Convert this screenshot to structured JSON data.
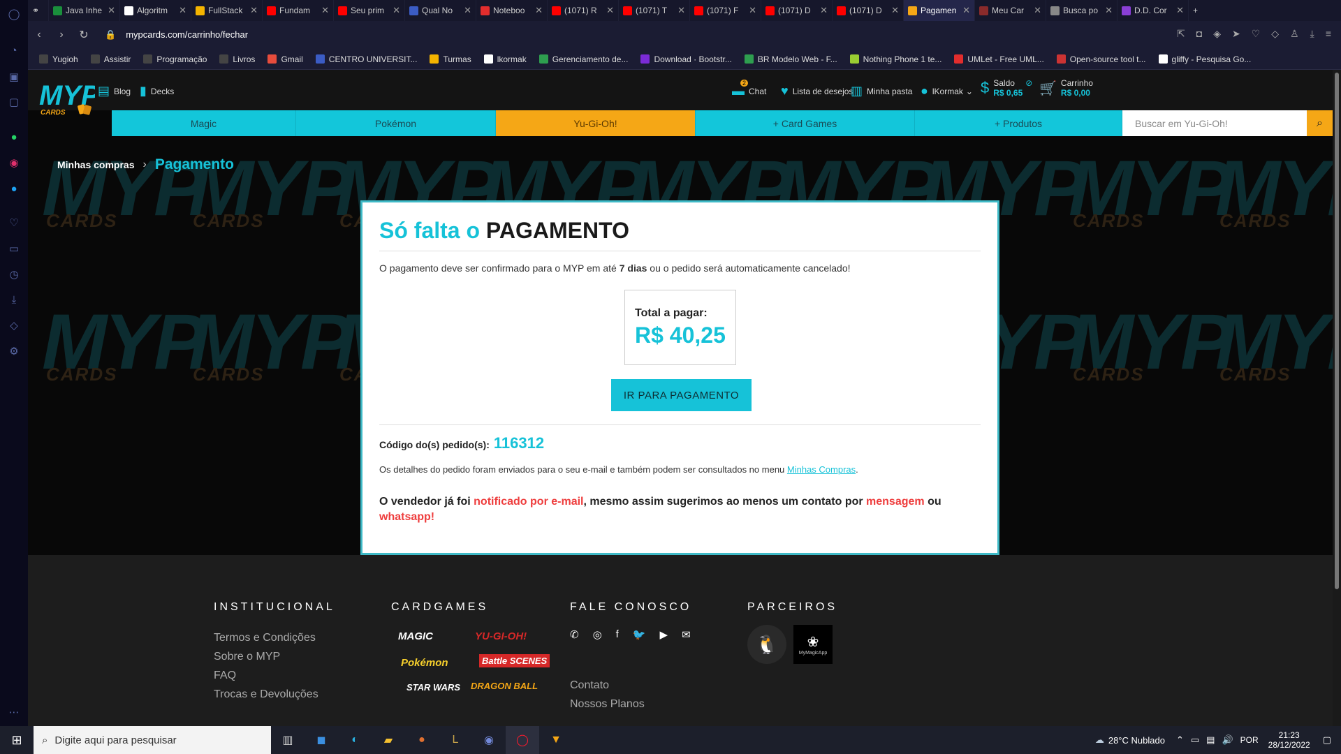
{
  "browser": {
    "tabs": [
      {
        "label": "Java Inhe",
        "color": "#1a8f3c"
      },
      {
        "label": "Algoritm",
        "color": "#ffffff"
      },
      {
        "label": "FullStack",
        "color": "#f4b400"
      },
      {
        "label": "Fundam",
        "color": "#ff0000"
      },
      {
        "label": "Seu prim",
        "color": "#ff0000"
      },
      {
        "label": "Qual No",
        "color": "#3b5cc4"
      },
      {
        "label": "Noteboo",
        "color": "#e22d2d"
      },
      {
        "label": "(1071) R",
        "color": "#ff0000"
      },
      {
        "label": "(1071) T",
        "color": "#ff0000"
      },
      {
        "label": "(1071) F",
        "color": "#ff0000"
      },
      {
        "label": "(1071) D",
        "color": "#ff0000"
      },
      {
        "label": "(1071) D",
        "color": "#ff0000"
      },
      {
        "label": "Pagamen",
        "color": "#f5a716",
        "active": true
      },
      {
        "label": "Meu Car",
        "color": "#8a2b2b"
      },
      {
        "label": "Busca po",
        "color": "#888888"
      },
      {
        "label": "D.D. Cor",
        "color": "#8a3fd6"
      }
    ],
    "url": "mypcards.com/carrinho/fechar",
    "bookmarks": [
      {
        "label": "Yugioh",
        "color": "#444"
      },
      {
        "label": "Assistir",
        "color": "#444"
      },
      {
        "label": "Programação",
        "color": "#444"
      },
      {
        "label": "Livros",
        "color": "#444"
      },
      {
        "label": "Gmail",
        "color": "#e74c3c"
      },
      {
        "label": "CENTRO UNIVERSIT...",
        "color": "#3b5cc4"
      },
      {
        "label": "Turmas",
        "color": "#f4b400"
      },
      {
        "label": "lkormak",
        "color": "#ffffff"
      },
      {
        "label": "Gerenciamento de...",
        "color": "#2e9e4f"
      },
      {
        "label": "Download · Bootstr...",
        "color": "#7b2bd6"
      },
      {
        "label": "BR Modelo Web - F...",
        "color": "#2e9e4f"
      },
      {
        "label": "Nothing Phone 1 te...",
        "color": "#9acd32"
      },
      {
        "label": "UMLet - Free UML...",
        "color": "#e22d2d"
      },
      {
        "label": "Open-source tool t...",
        "color": "#cc3333"
      },
      {
        "label": "gliffy - Pesquisa Go...",
        "color": "#ffffff"
      }
    ]
  },
  "site": {
    "logo_text": "MYP",
    "logo_sub": "CARDS",
    "top_links": {
      "blog": "Blog",
      "decks": "Decks"
    },
    "header": {
      "chat": "Chat",
      "chat_badge": "2",
      "wishlist": "Lista de desejos",
      "folder": "Minha pasta",
      "user": "lKormak",
      "saldo_label": "Saldo",
      "saldo_value": "R$ 0,65",
      "cart_label": "Carrinho",
      "cart_value": "R$ 0,00"
    },
    "nav": [
      {
        "label": "Magic"
      },
      {
        "label": "Pokémon"
      },
      {
        "label": "Yu-Gi-Oh!",
        "active": true
      },
      {
        "label": "+ Card Games"
      },
      {
        "label": "+ Produtos"
      }
    ],
    "search_placeholder": "Buscar em Yu-Gi-Oh!"
  },
  "breadcrumb": {
    "parent": "Minhas compras",
    "current": "Pagamento"
  },
  "payment": {
    "title_prefix": "Só falta o",
    "title_bold": "PAGAMENTO",
    "info_1": "O pagamento deve ser confirmado para o MYP em até ",
    "info_bold": "7 dias",
    "info_2": " ou o pedido será automaticamente cancelado!",
    "total_label": "Total a pagar:",
    "total_value": "R$ 40,25",
    "pay_button": "IR PARA PAGAMENTO",
    "order_label": "Código do(s) pedido(s):",
    "order_value": "116312",
    "details_1": "Os detalhes do pedido foram enviados para o seu e-mail e também podem ser consultados no menu ",
    "details_link": "Minhas Compras",
    "details_2": ".",
    "note_1": "O vendedor já foi ",
    "note_red_1": "notificado por e-mail",
    "note_2": ", mesmo assim sugerimos ao menos um contato por ",
    "note_red_2": "mensagem",
    "note_3": " ou ",
    "note_red_3": "whatsapp!"
  },
  "footer": {
    "institucional": {
      "title": "INSTITUCIONAL",
      "links": [
        "Termos e Condições",
        "Sobre o MYP",
        "FAQ",
        "Trocas e Devoluções"
      ]
    },
    "cardgames": {
      "title": "CARDGAMES",
      "logos": [
        "MAGIC",
        "YU-GI-OH!",
        "Pokémon",
        "Battle SCENES",
        "STAR WARS",
        "DRAGON BALL"
      ]
    },
    "contato": {
      "title": "FALE CONOSCO",
      "links": [
        "Contato",
        "Nossos Planos"
      ]
    },
    "parceiros": {
      "title": "PARCEIROS",
      "partner_2": "MyMagicApp"
    }
  },
  "taskbar": {
    "search_placeholder": "Digite aqui para pesquisar",
    "weather": "28°C  Nublado",
    "lang": "POR",
    "time": "21:23",
    "date": "28/12/2022"
  }
}
